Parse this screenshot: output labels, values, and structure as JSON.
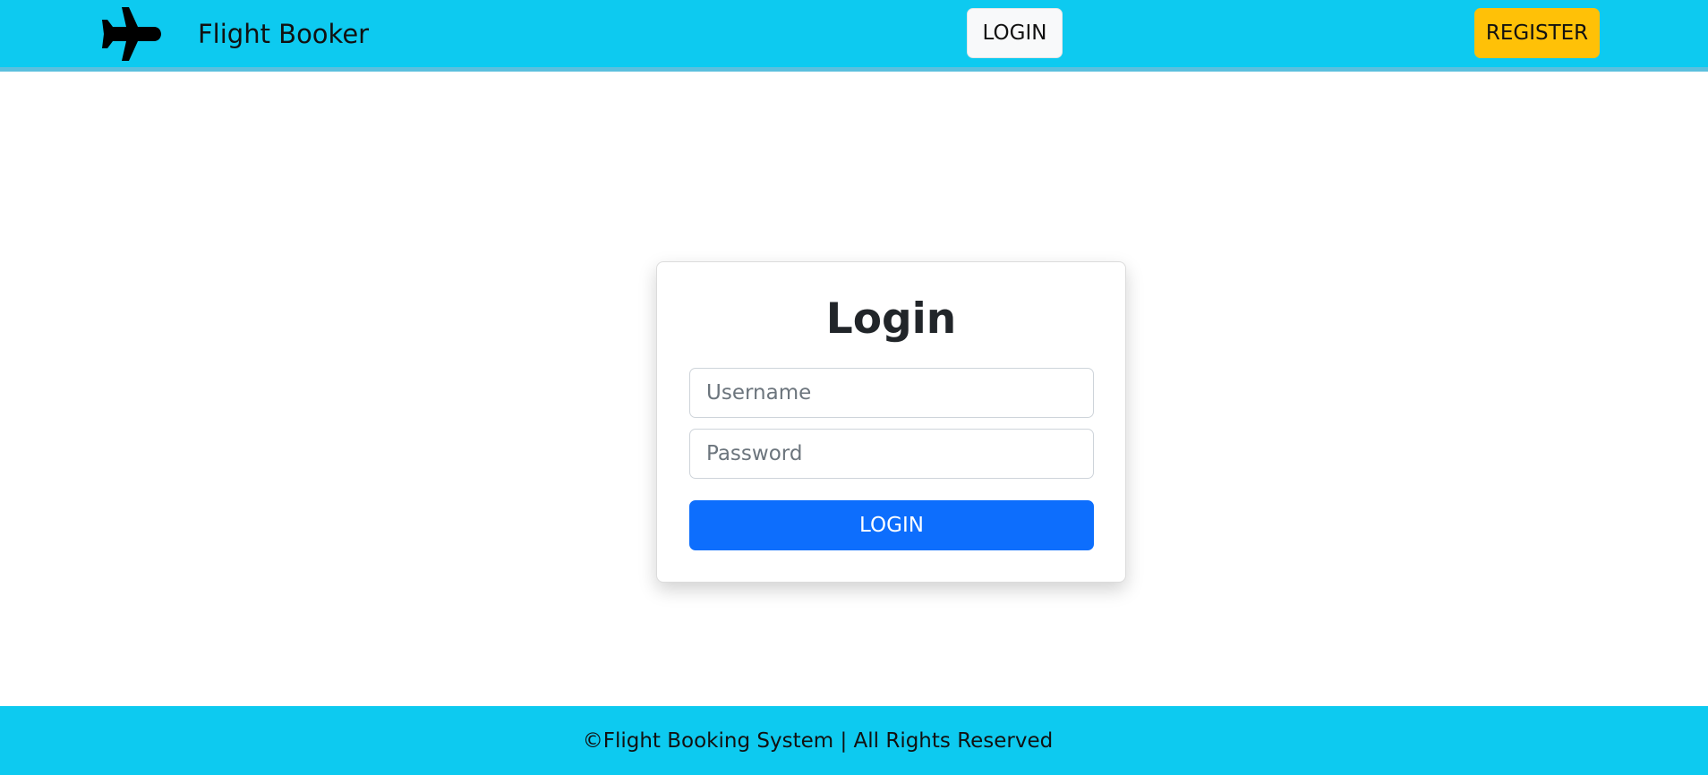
{
  "navbar": {
    "logo_icon": "airplane-icon",
    "brand": "Flight Booker",
    "login_label": "LOGIN",
    "register_label": "REGISTER"
  },
  "login_card": {
    "title": "Login",
    "username_placeholder": "Username",
    "password_placeholder": "Password",
    "submit_label": "LOGIN"
  },
  "footer": {
    "text": "©Flight Booking System | All Rights Reserved"
  },
  "colors": {
    "navbar_bg": "#0dcaf0",
    "register_bg": "#ffc107",
    "primary": "#0d6efd",
    "footer_bg": "#0dcaf0"
  }
}
